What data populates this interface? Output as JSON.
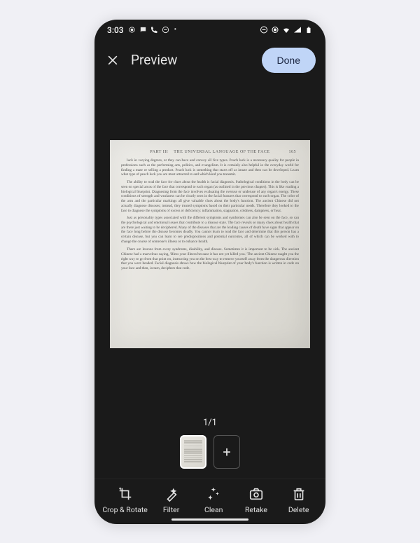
{
  "statusbar": {
    "time": "3:03",
    "left_icons": [
      "record-icon",
      "chat-icon",
      "phone-icon",
      "dnd-icon"
    ],
    "dot": "•",
    "right_icons": [
      "dnd-circle",
      "record-dot",
      "wifi",
      "signal",
      "battery"
    ]
  },
  "header": {
    "title": "Preview",
    "done_label": "Done"
  },
  "scan": {
    "header_part": "PART III",
    "header_title": "THE UNIVERSAL LANGUAGE OF THE FACE",
    "page_number": "165",
    "paragraphs": [
      "luck in varying degrees, or they can have and convey all five types. Peach luck is a necessary quality for people in professions such as the performing arts, politics, and evangelism. It is certainly also helpful in the everyday world for finding a mate or selling a product. Peach luck is something that starts off as innate and then can be developed. Learn what type of peach luck you are most attracted to and which kind you transmit.",
      "The ability to read the face for clues about the health is facial diagnosis. Pathological conditions in the body can be seen on special areas of the face that correspond to each organ (as outlined in the previous chapter). This is like reading a biological blueprint. Diagnosing from the face involves evaluating the overuse or underuse of any organ's energy. These conditions of strength and weakness can be clearly seen in the facial features that correspond to each organ. The color of the area and the particular markings all give valuable clues about the body's function. The ancient Chinese did not actually diagnose diseases; instead, they treated symptoms based on their particular needs. Therefore they looked to the face to diagnose the symptoms of excess or deficiency: inflammation, stagnation, coldness, dampness, or heat.",
      "Just as personality types associated with the different symptoms and syndromes can also be seen on the face, so can the psychological and emotional issues that contribute to a disease state. The face reveals so many clues about health that are there just waiting to be deciphered. Many of the diseases that are the leading causes of death have signs that appear on the face long before the disease becomes deadly. You cannot learn to read the face and determine that this person has a certain disease, but you can learn to see predispositions and potential outcomes, all of which can be worked with to change the course of someone's illness or to enhance health.",
      "There are lessons from every syndrome, disability, and disease. Sometimes it is important to be sick. The ancient Chinese had a marvelous saying, 'Bless your illness because it has not yet killed you.' The ancient Chinese taught you the right way to go from that point on, instructing you on the best way to remove yourself away from the dangerous direction that you were headed. Facial diagnosis shows how the biological blueprint of your body's function is written in code on your face and then, in turn, deciphers that code."
    ]
  },
  "counter": "1/1",
  "thumbnails": {
    "add_label": "+"
  },
  "toolbar": {
    "crop_label": "Crop & Rotate",
    "filter_label": "Filter",
    "clean_label": "Clean",
    "retake_label": "Retake",
    "delete_label": "Delete"
  }
}
